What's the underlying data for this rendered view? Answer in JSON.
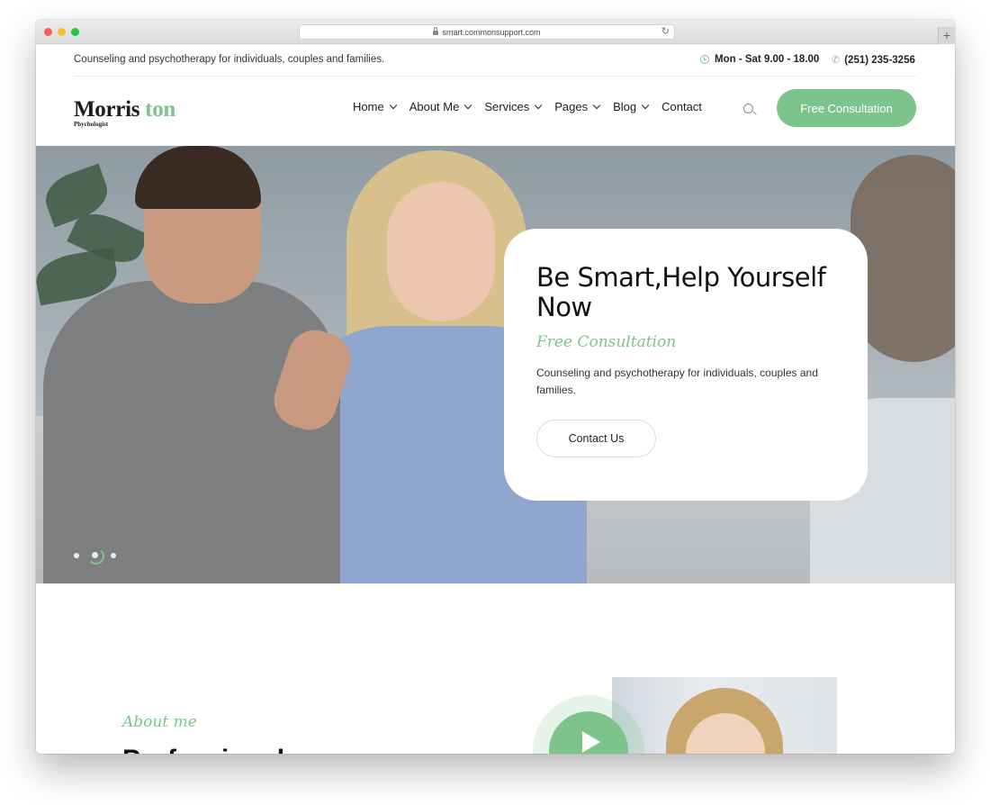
{
  "browser": {
    "url": "smart.commonsupport.com",
    "new_tab_label": "+"
  },
  "topbar": {
    "tagline": "Counseling and psychotherapy for individuals, couples and families.",
    "hours": "Mon - Sat 9.00 - 18.00",
    "phone": "(251) 235-3256"
  },
  "logo": {
    "name_part1": "Morris",
    "name_part2": "ton",
    "subtitle": "Phychologist"
  },
  "nav": {
    "items": [
      {
        "label": "Home",
        "has_dropdown": true
      },
      {
        "label": "About Me",
        "has_dropdown": true
      },
      {
        "label": "Services",
        "has_dropdown": true
      },
      {
        "label": "Pages",
        "has_dropdown": true
      },
      {
        "label": "Blog",
        "has_dropdown": true
      },
      {
        "label": "Contact",
        "has_dropdown": false
      }
    ],
    "cta_label": "Free Consultation"
  },
  "hero": {
    "title": "Be Smart,Help Yourself Now",
    "script_label": "Free Consultation",
    "description": "Counseling and psychotherapy for individuals, couples and families.",
    "button_label": "Contact Us",
    "slide_count": 3,
    "active_slide": 2
  },
  "about": {
    "label": "About me",
    "heading": "Professional"
  },
  "colors": {
    "accent": "#7cc48b",
    "text_dark": "#111111"
  }
}
